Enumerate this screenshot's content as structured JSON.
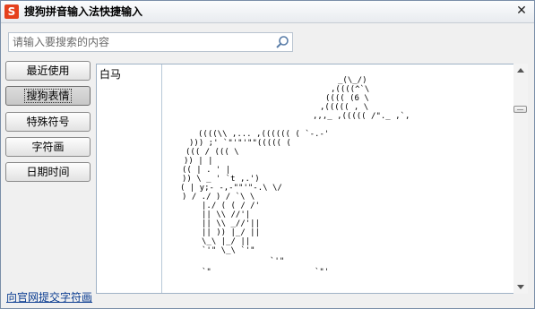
{
  "window": {
    "title": "搜狗拼音输入法快捷输入",
    "app_icon_letter": "S",
    "close_symbol": "✕"
  },
  "search": {
    "placeholder": "请输入要搜索的内容",
    "value": "",
    "icon": "search-icon"
  },
  "categories": [
    {
      "label": "最近使用",
      "active": false
    },
    {
      "label": "搜狗表情",
      "active": true
    },
    {
      "label": "特殊符号",
      "active": false
    },
    {
      "label": "字符画",
      "active": false
    },
    {
      "label": "日期时间",
      "active": false
    }
  ],
  "list": {
    "items": [
      "白马"
    ]
  },
  "preview": {
    "subject": "horse ascii art"
  },
  "footer": {
    "link_label": "向官网提交字符画"
  },
  "colors": {
    "brand": "#e5411d",
    "link": "#0b3d91",
    "border": "#9fb2c6"
  }
}
